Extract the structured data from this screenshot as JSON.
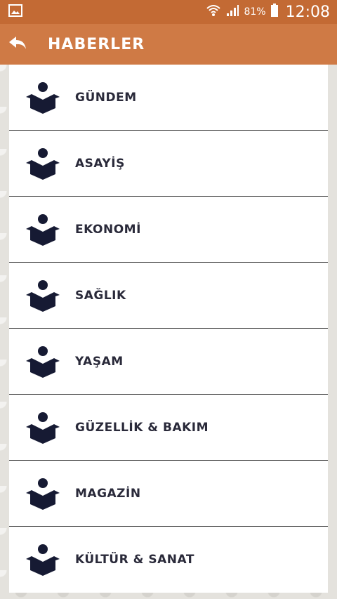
{
  "status_bar": {
    "battery_percent": "81%",
    "time": "12:08"
  },
  "app_bar": {
    "title": "HABERLER"
  },
  "categories": [
    {
      "label": "GÜNDEM"
    },
    {
      "label": "ASAYİŞ"
    },
    {
      "label": "EKONOMİ"
    },
    {
      "label": "SAĞLIK"
    },
    {
      "label": "YAŞAM"
    },
    {
      "label": "GÜZELLİK & BAKIM"
    },
    {
      "label": "MAGAZİN"
    },
    {
      "label": "KÜLTÜR & SANAT"
    }
  ],
  "colors": {
    "status_bar": "#c36a34",
    "app_bar": "#cf7a45",
    "icon": "#161a33"
  },
  "icons": {
    "back": "back-arrow-icon",
    "category": "reader-icon"
  }
}
